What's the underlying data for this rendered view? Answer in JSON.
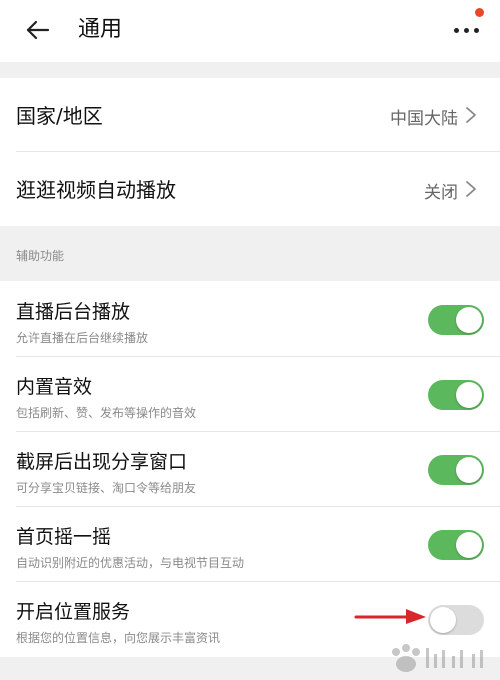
{
  "header": {
    "title": "通用"
  },
  "general": {
    "items": [
      {
        "label": "国家/地区",
        "value": "中国大陆"
      },
      {
        "label": "逛逛视频自动播放",
        "value": "关闭"
      }
    ]
  },
  "accessibility": {
    "section_title": "辅助功能",
    "items": [
      {
        "title": "直播后台播放",
        "subtitle": "允许直播在后台继续播放",
        "enabled": true
      },
      {
        "title": "内置音效",
        "subtitle": "包括刷新、赞、发布等操作的音效",
        "enabled": true
      },
      {
        "title": "截屏后出现分享窗口",
        "subtitle": "可分享宝贝链接、淘口令等给朋友",
        "enabled": true
      },
      {
        "title": "首页摇一摇",
        "subtitle": "自动识别附近的优惠活动，与电视节目互动",
        "enabled": true
      },
      {
        "title": "开启位置服务",
        "subtitle": "根据您的位置信息，向您展示丰富资讯",
        "enabled": false
      }
    ]
  },
  "colors": {
    "toggle_on": "#5cb85c",
    "toggle_off": "#dcdcdc",
    "badge": "#e8472a",
    "annotation_arrow": "#d9262c"
  },
  "icons": {
    "back": "arrow-left-icon",
    "more": "more-dots-icon",
    "chevron": "chevron-right-icon"
  }
}
